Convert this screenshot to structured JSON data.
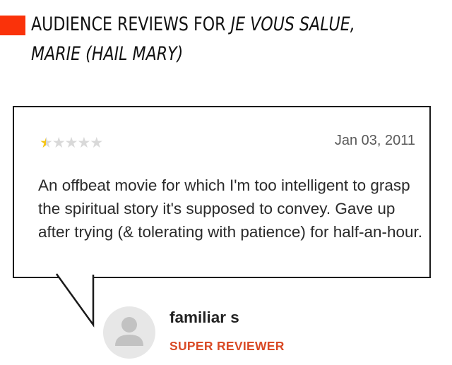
{
  "section": {
    "title_prefix": "AUDIENCE REVIEWS FOR",
    "title_movie_line1": "JE VOUS SALUE,",
    "title_movie_line2": "MARIE (HAIL MARY)",
    "accent_color": "#fa320a"
  },
  "review": {
    "rating": 0.5,
    "rating_max": 5,
    "star_icon": "star-icon",
    "date": "Jan 03, 2011",
    "text": "An offbeat movie for which I'm too intelligent to grasp the spiritual story it's supposed to convey. Gave up after trying (& tolerating with patience) for half-an-hour.",
    "reviewer": {
      "name": "familiar s",
      "badge": "SUPER REVIEWER",
      "avatar_icon": "default-user-avatar",
      "badge_color": "#d94a26"
    }
  }
}
